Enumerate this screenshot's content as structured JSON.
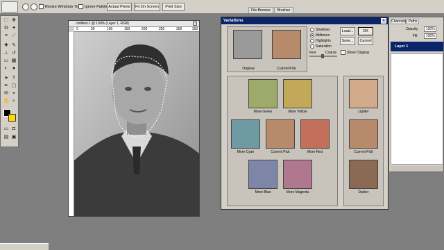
{
  "options_bar": {
    "resize_label": "Resize Windows To Fit",
    "ignore_label": "Ignore Palettes",
    "actual_pixels": "Actual Pixels",
    "fit_on_screen": "Fit On Screen",
    "print_size": "Print Size",
    "tabs": [
      "File Browser",
      "Brushes"
    ]
  },
  "document": {
    "title": "Untitled-1 @ 100% (Layer 1, RGB)",
    "ruler_labels": [
      "0",
      "50",
      "100",
      "150",
      "200",
      "250",
      "300",
      "350"
    ]
  },
  "variations": {
    "title": "Variations",
    "original_label": "Original",
    "current_pick_label": "Current Pick",
    "tone_options": [
      "Shadows",
      "Midtones",
      "Highlights",
      "Saturation"
    ],
    "selected_tone": "Midtones",
    "fine_label": "Fine",
    "coarse_label": "Coarse",
    "ok": "OK",
    "cancel": "Cancel",
    "load": "Load...",
    "save": "Save...",
    "show_clipping": "Show Clipping",
    "grid": [
      "More Green",
      "More Yellow",
      "More Cyan",
      "Current Pick",
      "More Red",
      "More Blue",
      "More Magenta"
    ],
    "lighter_label": "Lighter",
    "current_pick_right": "Current Pick",
    "darker_label": "Darker"
  },
  "palette": {
    "tabs": [
      "Channels",
      "Paths"
    ],
    "opacity_label": "Opacity:",
    "opacity_value": "100%",
    "fill_label": "Fill:",
    "fill_value": "100%",
    "layer_name": "Layer 1"
  }
}
